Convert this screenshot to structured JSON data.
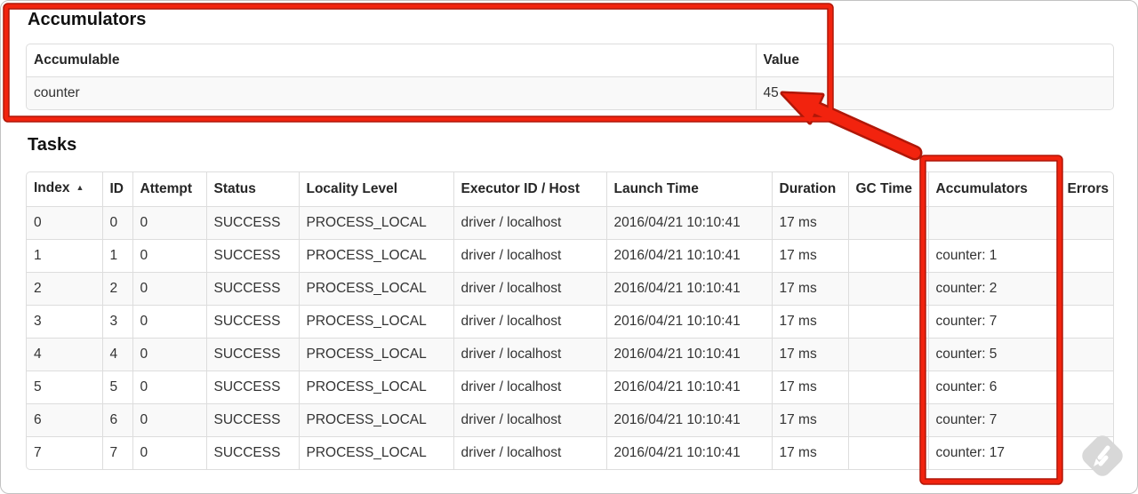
{
  "annotation": {
    "color": "#f2230e",
    "outline_color": "#b01708"
  },
  "accumulators_section": {
    "heading": "Accumulators",
    "table": {
      "headers": [
        "Accumulable",
        "Value"
      ],
      "rows": [
        {
          "accumulable": "counter",
          "value": "45"
        }
      ]
    }
  },
  "tasks_section": {
    "heading": "Tasks",
    "table": {
      "headers": [
        "Index",
        "ID",
        "Attempt",
        "Status",
        "Locality Level",
        "Executor ID / Host",
        "Launch Time",
        "Duration",
        "GC Time",
        "Accumulators",
        "Errors"
      ],
      "sort_indicator": "▲",
      "rows": [
        {
          "index": "0",
          "id": "0",
          "attempt": "0",
          "status": "SUCCESS",
          "locality": "PROCESS_LOCAL",
          "executor": "driver / localhost",
          "launch": "2016/04/21 10:10:41",
          "duration": "17 ms",
          "gc": "",
          "accum": "",
          "errors": ""
        },
        {
          "index": "1",
          "id": "1",
          "attempt": "0",
          "status": "SUCCESS",
          "locality": "PROCESS_LOCAL",
          "executor": "driver / localhost",
          "launch": "2016/04/21 10:10:41",
          "duration": "17 ms",
          "gc": "",
          "accum": "counter: 1",
          "errors": ""
        },
        {
          "index": "2",
          "id": "2",
          "attempt": "0",
          "status": "SUCCESS",
          "locality": "PROCESS_LOCAL",
          "executor": "driver / localhost",
          "launch": "2016/04/21 10:10:41",
          "duration": "17 ms",
          "gc": "",
          "accum": "counter: 2",
          "errors": ""
        },
        {
          "index": "3",
          "id": "3",
          "attempt": "0",
          "status": "SUCCESS",
          "locality": "PROCESS_LOCAL",
          "executor": "driver / localhost",
          "launch": "2016/04/21 10:10:41",
          "duration": "17 ms",
          "gc": "",
          "accum": "counter: 7",
          "errors": ""
        },
        {
          "index": "4",
          "id": "4",
          "attempt": "0",
          "status": "SUCCESS",
          "locality": "PROCESS_LOCAL",
          "executor": "driver / localhost",
          "launch": "2016/04/21 10:10:41",
          "duration": "17 ms",
          "gc": "",
          "accum": "counter: 5",
          "errors": ""
        },
        {
          "index": "5",
          "id": "5",
          "attempt": "0",
          "status": "SUCCESS",
          "locality": "PROCESS_LOCAL",
          "executor": "driver / localhost",
          "launch": "2016/04/21 10:10:41",
          "duration": "17 ms",
          "gc": "",
          "accum": "counter: 6",
          "errors": ""
        },
        {
          "index": "6",
          "id": "6",
          "attempt": "0",
          "status": "SUCCESS",
          "locality": "PROCESS_LOCAL",
          "executor": "driver / localhost",
          "launch": "2016/04/21 10:10:41",
          "duration": "17 ms",
          "gc": "",
          "accum": "counter: 7",
          "errors": ""
        },
        {
          "index": "7",
          "id": "7",
          "attempt": "0",
          "status": "SUCCESS",
          "locality": "PROCESS_LOCAL",
          "executor": "driver / localhost",
          "launch": "2016/04/21 10:10:41",
          "duration": "17 ms",
          "gc": "",
          "accum": "counter: 17",
          "errors": ""
        }
      ]
    }
  }
}
